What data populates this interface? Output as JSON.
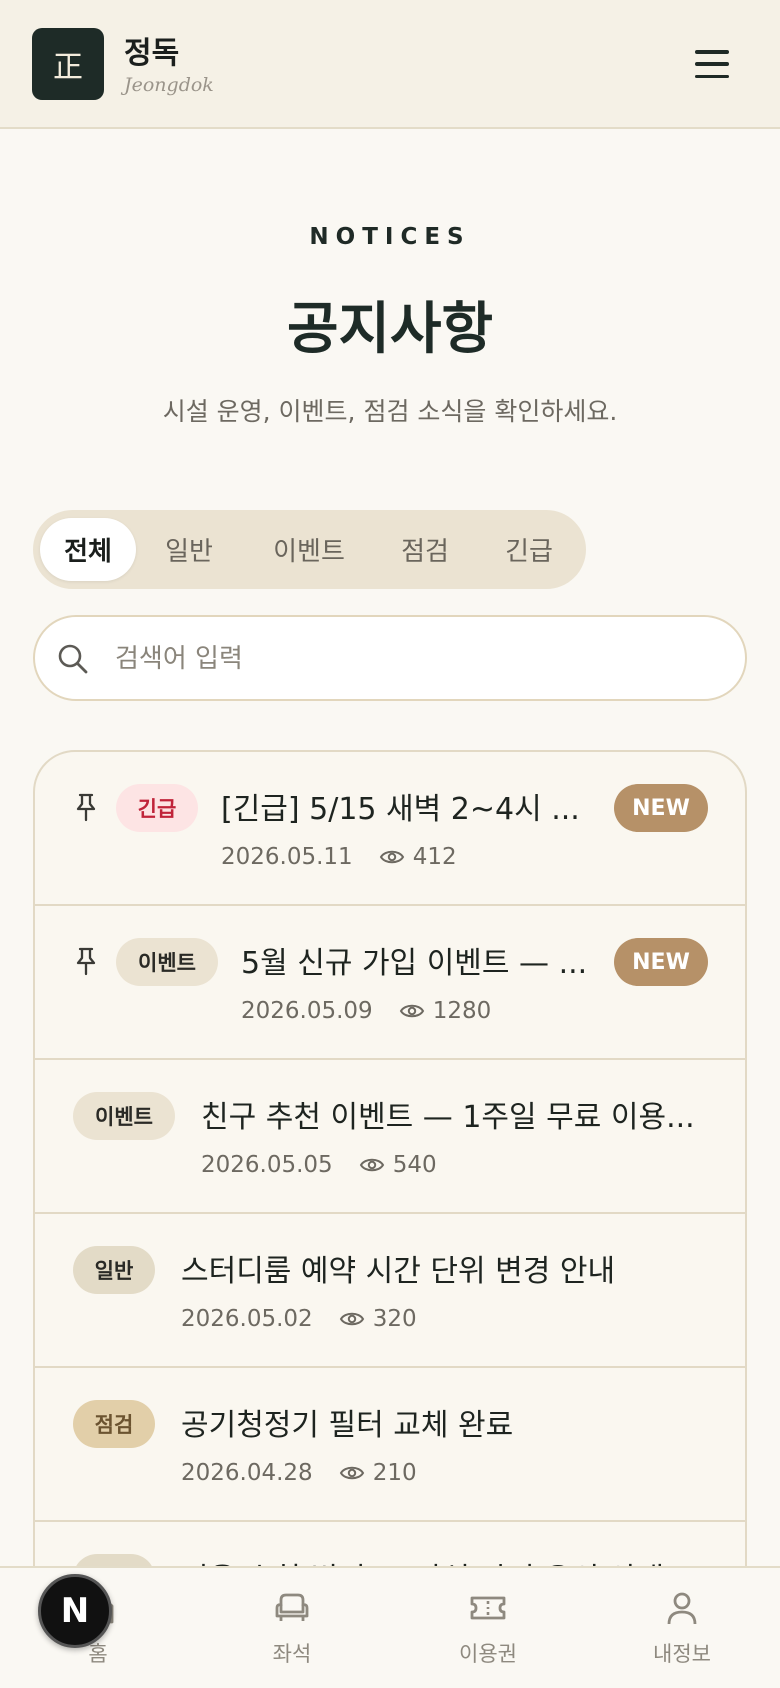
{
  "header": {
    "logo_char": "正",
    "brand_name": "정독",
    "brand_sub": "Jeongdok"
  },
  "hero": {
    "eyebrow": "NOTICES",
    "title": "공지사항",
    "description": "시설 운영, 이벤트, 점검 소식을 확인하세요."
  },
  "tabs": [
    "전체",
    "일반",
    "이벤트",
    "점검",
    "긴급"
  ],
  "active_tab": "전체",
  "search": {
    "placeholder": "검색어 입력",
    "value": ""
  },
  "notices": [
    {
      "pinned": true,
      "category": "긴급",
      "title": "[긴급] 5/15 새벽 2~4시 ...",
      "date": "2026.05.11",
      "views": "412",
      "new": "NEW"
    },
    {
      "pinned": true,
      "category": "이벤트",
      "title": "5월 신규 가입 이벤트 — ...",
      "date": "2026.05.09",
      "views": "1280",
      "new": "NEW"
    },
    {
      "pinned": false,
      "category": "이벤트",
      "title": "친구 추천 이벤트 — 1주일 무료 이용...",
      "date": "2026.05.05",
      "views": "540"
    },
    {
      "pinned": false,
      "category": "일반",
      "title": "스터디룸 예약 시간 단위 변경 안내",
      "date": "2026.05.02",
      "views": "320"
    },
    {
      "pinned": false,
      "category": "점검",
      "title": "공기청정기 필터 교체 완료",
      "date": "2026.04.28",
      "views": "210"
    },
    {
      "pinned": false,
      "category": "일반",
      "title": "이용 수칙 변경 — 좌석 자리 유의 안내",
      "date": "",
      "views": ""
    }
  ],
  "bottom_nav": [
    {
      "label": "홈",
      "icon": "home-icon"
    },
    {
      "label": "좌석",
      "icon": "seat-icon"
    },
    {
      "label": "이용권",
      "icon": "ticket-icon"
    },
    {
      "label": "내정보",
      "icon": "user-icon"
    }
  ],
  "dev_badge": "N",
  "colors": {
    "brand_dark": "#1e2b27",
    "new_badge": "#b69168",
    "urgent_bg": "#fde4e4",
    "urgent_text": "#c0243a",
    "event_bg": "#ebe3d2",
    "general_bg": "#e3dbc7",
    "maintenance_bg": "#e2cfa9"
  }
}
